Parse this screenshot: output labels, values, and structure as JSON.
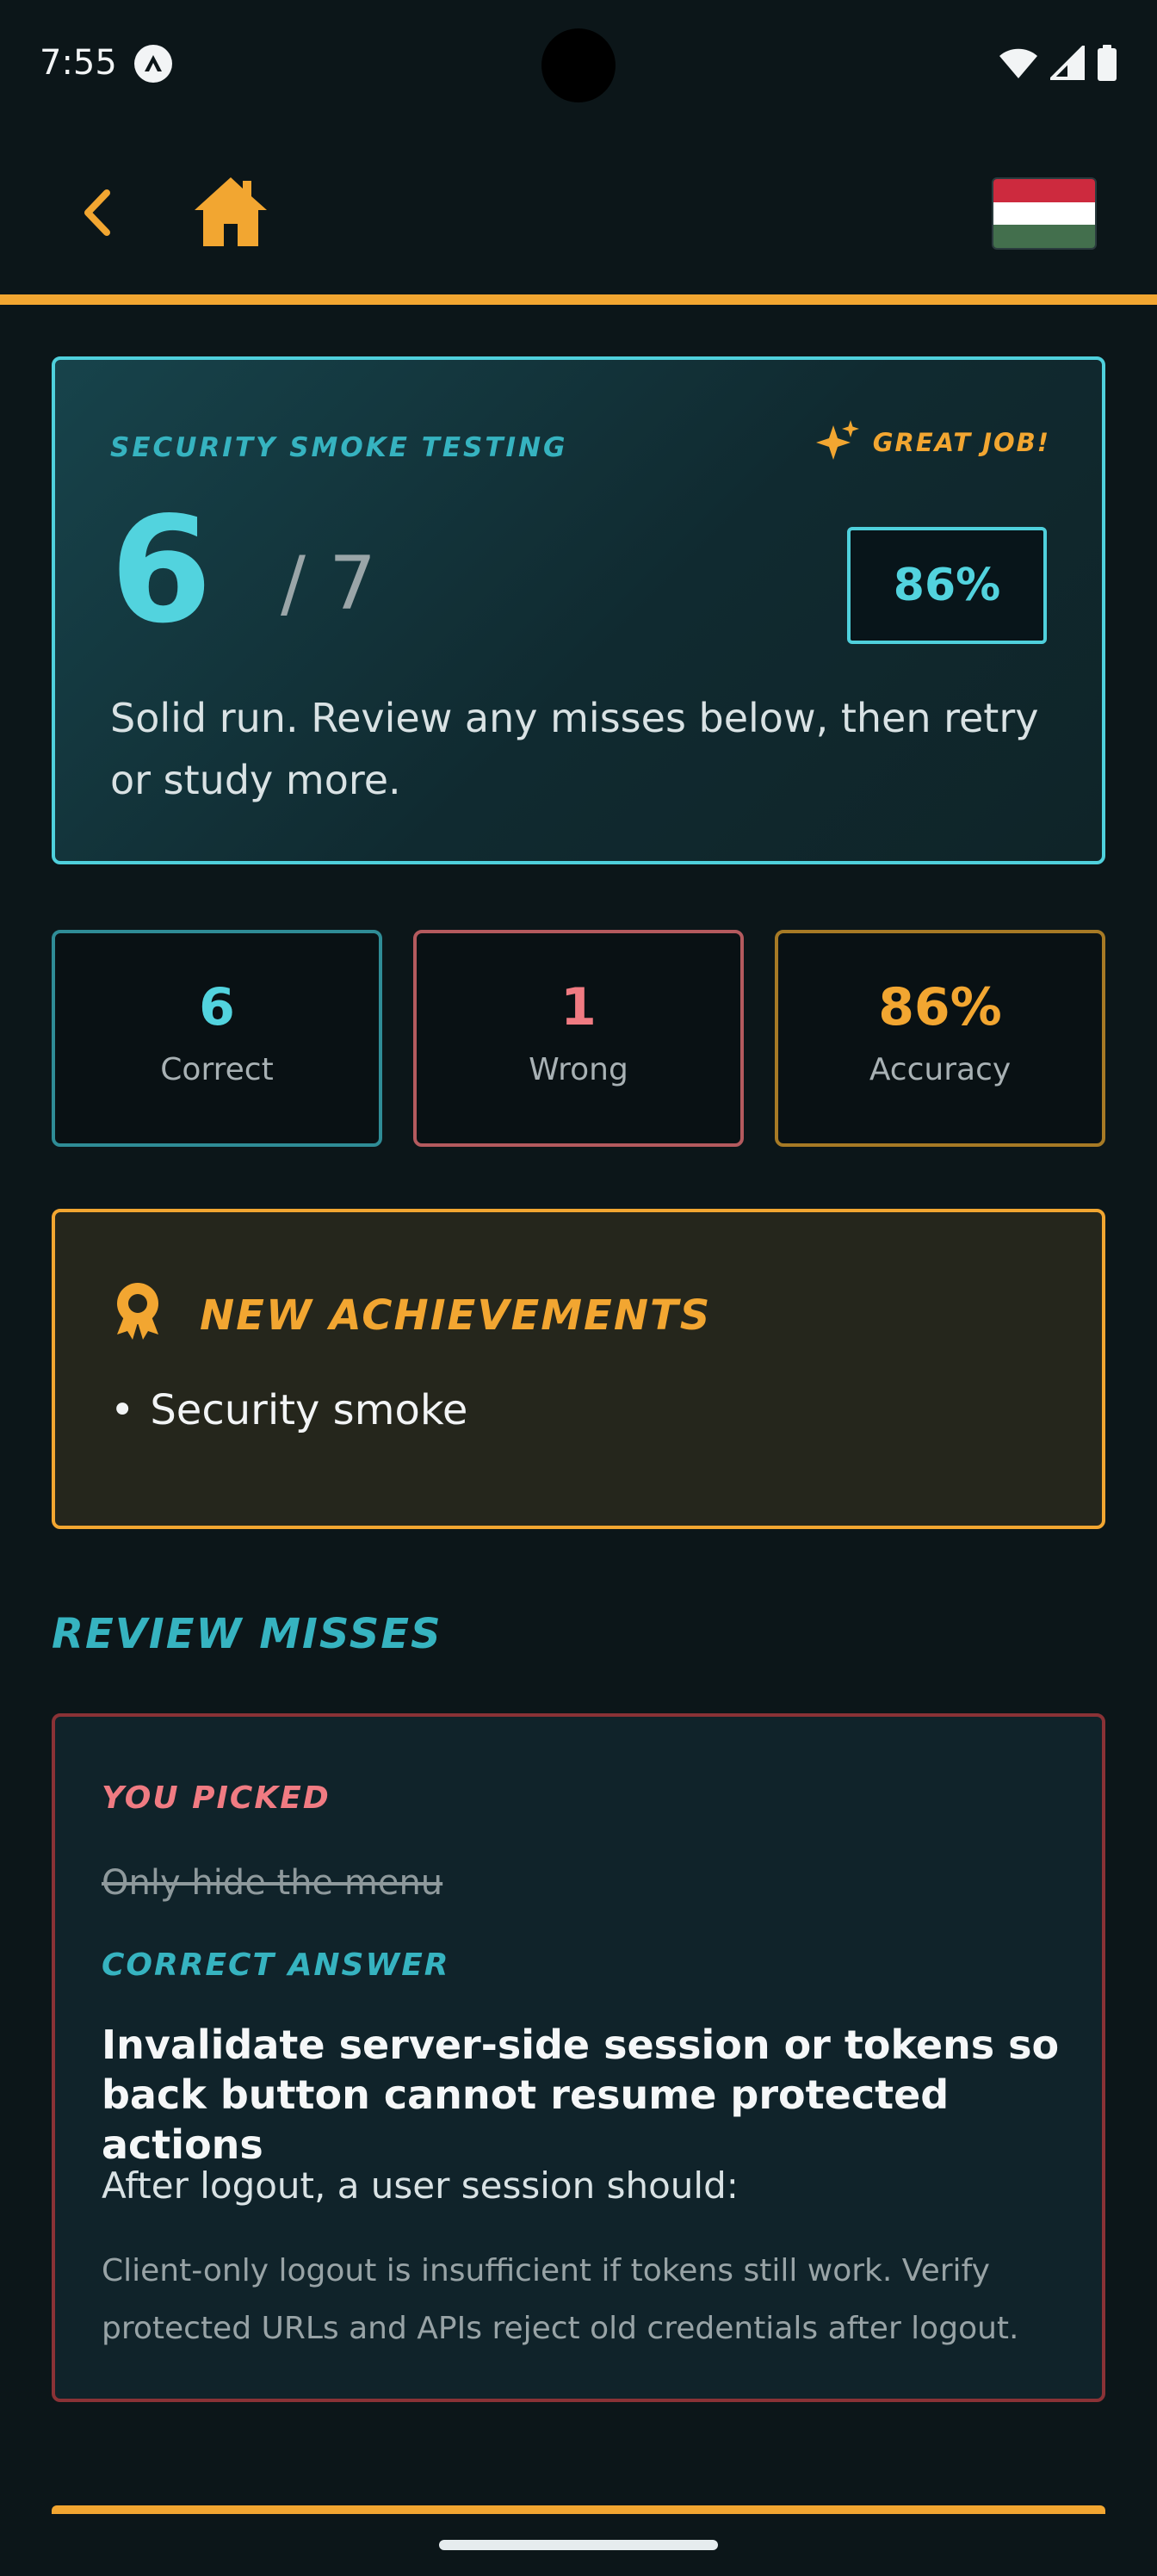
{
  "status_bar": {
    "time": "7:55"
  },
  "nav": {
    "flag_colors": [
      "#cd2a3e",
      "#ffffff",
      "#436f4d"
    ]
  },
  "result": {
    "topic": "Security smoke testing",
    "badge": "Great job!",
    "score": "6",
    "total": "/ 7",
    "percent": "86%",
    "message": "Solid run. Review any misses below, then retry or study more."
  },
  "stats": {
    "correct": {
      "value": "6",
      "label": "Correct"
    },
    "wrong": {
      "value": "1",
      "label": "Wrong"
    },
    "accuracy": {
      "value": "86%",
      "label": "Accuracy"
    }
  },
  "achievements": {
    "title": "New achievements",
    "items": [
      "Security smoke"
    ]
  },
  "review": {
    "title": "Review misses",
    "items": [
      {
        "picked_label": "You picked",
        "picked": "Only hide the menu",
        "correct_label": "Correct answer",
        "correct": "Invalidate server-side session or tokens so back button cannot resume protected actions",
        "question": "After logout, a user session should:",
        "explanation": "Client-only logout is insufficient if tokens still work. Verify protected URLs and APIs reject old credentials after logout."
      }
    ]
  },
  "colors": {
    "accent": "#f2a631",
    "teal": "#52d3de",
    "wrong": "#f07b82",
    "background": "#0c1619"
  }
}
